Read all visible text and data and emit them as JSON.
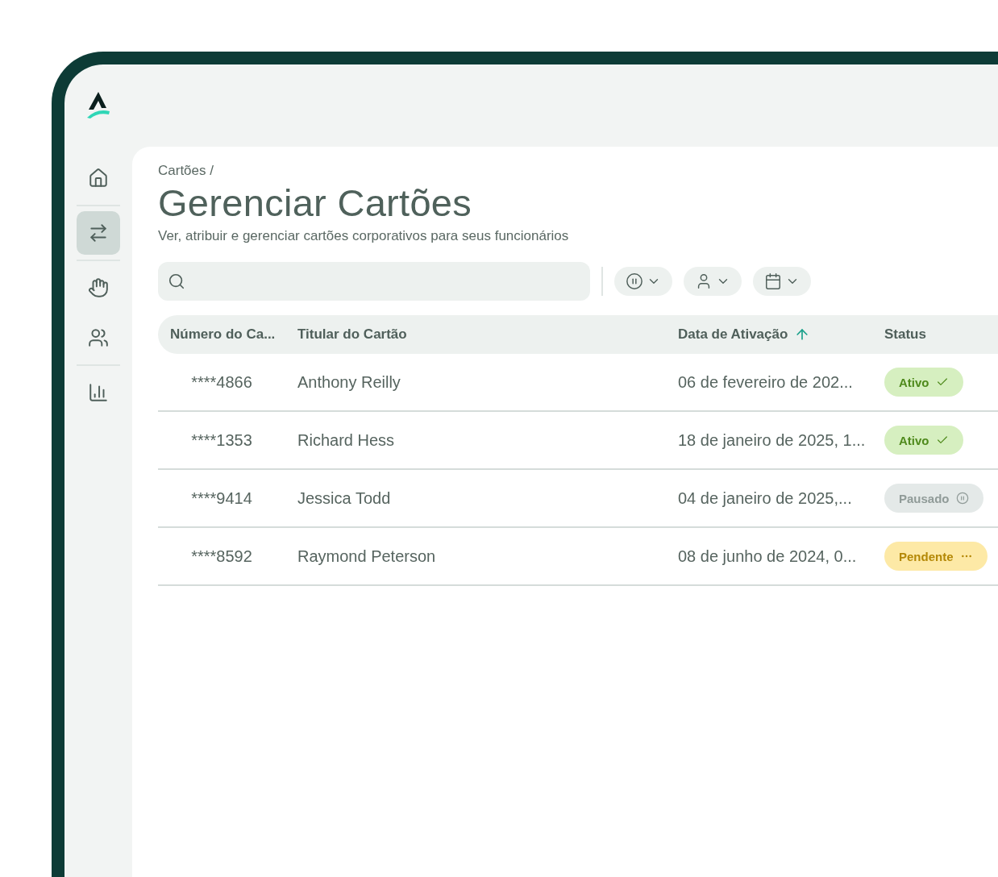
{
  "sidebar": {
    "groups": [
      {
        "items": [
          {
            "selected": false
          }
        ]
      },
      {
        "items": [
          {
            "selected": true
          }
        ]
      },
      {
        "items": [
          {
            "selected": false
          },
          {
            "selected": false
          }
        ]
      },
      {
        "items": [
          {
            "selected": false
          }
        ]
      }
    ]
  },
  "breadcrumb": "Cartões /",
  "title": "Gerenciar Cartões",
  "subtitle": "Ver, atribuir e gerenciar cartões corporativos para seus funcionários",
  "filters": [
    {
      "kind": "status"
    },
    {
      "kind": "person"
    },
    {
      "kind": "date"
    }
  ],
  "table": {
    "columns": [
      {
        "label": "Número do Ca..."
      },
      {
        "label": "Titular do Cartão"
      },
      {
        "label": "Data de Ativação",
        "sorted": true
      },
      {
        "label": "Status"
      }
    ],
    "rows": [
      {
        "number": "****4866",
        "holder": "Anthony Reilly",
        "date": "06 de fevereiro de 202...",
        "status": {
          "label": "Ativo",
          "kind": "active"
        }
      },
      {
        "number": "****1353",
        "holder": "Richard Hess",
        "date": "18 de janeiro de 2025, 1...",
        "status": {
          "label": "Ativo",
          "kind": "active"
        }
      },
      {
        "number": "****9414",
        "holder": "Jessica Todd",
        "date": "04 de janeiro de 2025,...",
        "status": {
          "label": "Pausado",
          "kind": "paused"
        }
      },
      {
        "number": "****8592",
        "holder": "Raymond Peterson",
        "date": "08 de junho de 2024, 0...",
        "status": {
          "label": "Pendente",
          "kind": "pending"
        }
      }
    ]
  }
}
